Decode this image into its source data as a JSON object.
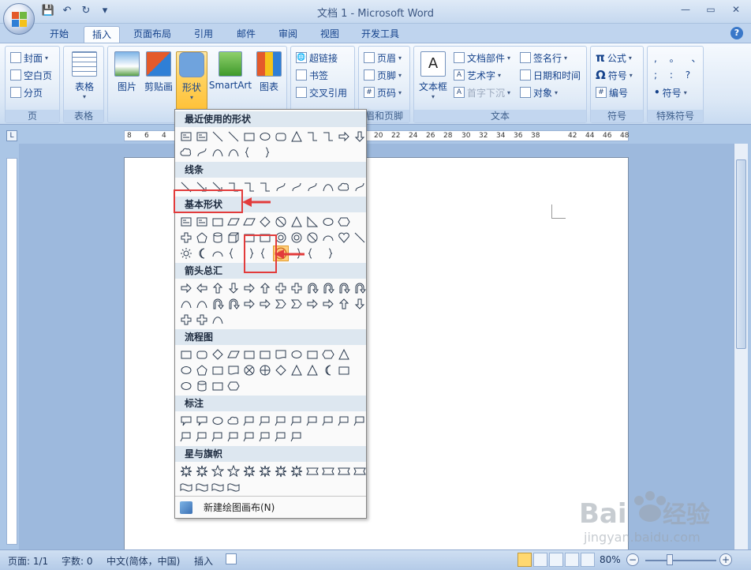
{
  "window": {
    "title": "文档 1 - Microsoft Word"
  },
  "tabs": [
    {
      "label": "开始"
    },
    {
      "label": "插入"
    },
    {
      "label": "页面布局"
    },
    {
      "label": "引用"
    },
    {
      "label": "邮件"
    },
    {
      "label": "审阅"
    },
    {
      "label": "视图"
    },
    {
      "label": "开发工具"
    }
  ],
  "ribbon": {
    "pages": {
      "cover": "封面",
      "blank": "空白页",
      "break": "分页",
      "label": "页"
    },
    "table": {
      "label": "表格",
      "group_label": "表格"
    },
    "illustrations": {
      "picture": "图片",
      "clipart": "剪贴画",
      "shapes": "形状",
      "smartart": "SmartArt",
      "chart": "图表"
    },
    "links": {
      "hyperlink": "超链接",
      "bookmark": "书签",
      "crossref": "交叉引用"
    },
    "header_footer": {
      "header": "页眉",
      "footer": "页脚",
      "page_number": "页码",
      "label": "眉和页脚"
    },
    "text": {
      "textbox": "文本框",
      "quickparts": "文档部件",
      "wordart": "艺术字",
      "dropcap": "首字下沉",
      "signature": "签名行",
      "datetime": "日期和时间",
      "object": "对象",
      "label": "文本"
    },
    "symbols": {
      "equation": "公式",
      "symbol": "符号",
      "number": "编号",
      "label": "符号"
    },
    "special": {
      "row1": ",  。 、",
      "row2": ";  :  ?",
      "symbol": "符号",
      "label": "特殊符号"
    }
  },
  "ruler": {
    "ticks": [
      "8",
      "6",
      "4",
      "20",
      "22",
      "24",
      "26",
      "28",
      "30",
      "32",
      "34",
      "36",
      "38",
      "42",
      "44",
      "46",
      "48"
    ]
  },
  "shapes_menu": {
    "sections": [
      {
        "title": "最近使用的形状"
      },
      {
        "title": "线条"
      },
      {
        "title": "基本形状"
      },
      {
        "title": "箭头总汇"
      },
      {
        "title": "流程图"
      },
      {
        "title": "标注"
      },
      {
        "title": "星与旗帜"
      }
    ],
    "footer": "新建绘图画布(N)"
  },
  "statusbar": {
    "page": "页面: 1/1",
    "words": "字数: 0",
    "language": "中文(简体，中国)",
    "mode": "插入",
    "zoom": "80%"
  },
  "watermark": {
    "brand": "Baidu经验",
    "url": "jingyan.baidu.com"
  }
}
